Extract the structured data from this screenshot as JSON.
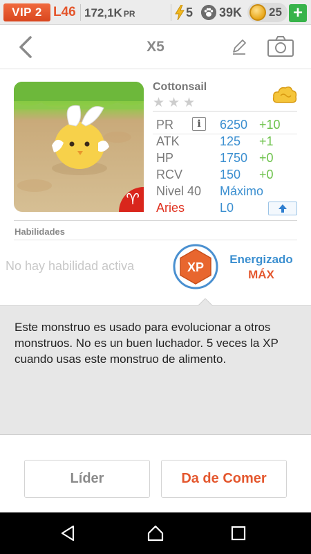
{
  "statusbar": {
    "vip": "VIP 2",
    "level": "L46",
    "pr_value": "172,1K",
    "pr_unit": "PR",
    "energy": "5",
    "paws": "39K",
    "coins": "25",
    "add_label": "+"
  },
  "header": {
    "title": "X5"
  },
  "monster": {
    "name": "Cottonsail",
    "stars_total": 3,
    "stars_filled": 0,
    "stats": [
      {
        "label": "PR",
        "value": "6250",
        "bonus": "+10"
      },
      {
        "label": "ATK",
        "value": "125",
        "bonus": "+1"
      },
      {
        "label": "HP",
        "value": "1750",
        "bonus": "+0"
      },
      {
        "label": "RCV",
        "value": "150",
        "bonus": "+0"
      }
    ],
    "level_label": "Nivel 40",
    "level_value": "Máximo",
    "sign_label": "Aries",
    "sign_value": "L0",
    "sign_glyph": "♈",
    "info_glyph": "i"
  },
  "skills": {
    "title": "Habilidades",
    "empty": "No hay habilidad activa",
    "badge_text": "XP",
    "energized_label": "Energizado",
    "energized_level": "MÁX"
  },
  "description": "Este monstruo es usado para evolucionar a otros monstruos. No es un buen luchador. 5 veces la XP cuando usas este monstruo de alimento.",
  "buttons": {
    "leader": "Líder",
    "feed": "Da de Comer"
  },
  "colors": {
    "accent_orange": "#e4572e",
    "stat_blue": "#3b8fd0",
    "bonus_green": "#6cc24a",
    "aries_red": "#e0301e"
  }
}
